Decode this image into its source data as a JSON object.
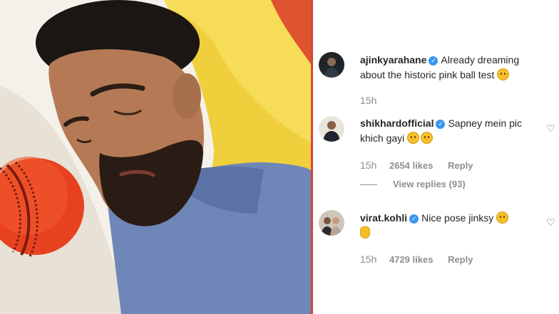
{
  "post": {
    "image_alt": "Man sleeping on a pillow next to a pink cricket ball"
  },
  "comments": [
    {
      "username": "ajinkyarahane",
      "text": "Already dreaming about the historic pink ball test",
      "emojis": [
        "smiling-face-emoji"
      ],
      "time": "15h",
      "likes": "",
      "reply_label": ""
    },
    {
      "username": "shikhardofficial",
      "text": "Sapney mein pic khich gayi",
      "emojis": [
        "face-with-tongue-emoji",
        "face-with-tongue-emoji"
      ],
      "time": "15h",
      "likes": "2654 likes",
      "reply_label": "Reply",
      "view_replies": "View replies (93)"
    },
    {
      "username": "virat.kohli",
      "text": "Nice pose jinksy",
      "emojis": [
        "zany-face-emoji",
        "ok-hand-emoji"
      ],
      "time": "15h",
      "likes": "4729 likes",
      "reply_label": "Reply"
    }
  ],
  "colors": {
    "verified_badge": "#3897f0",
    "username": "#262626",
    "meta_text": "#8e8e8e",
    "divider": "#d4463c"
  }
}
